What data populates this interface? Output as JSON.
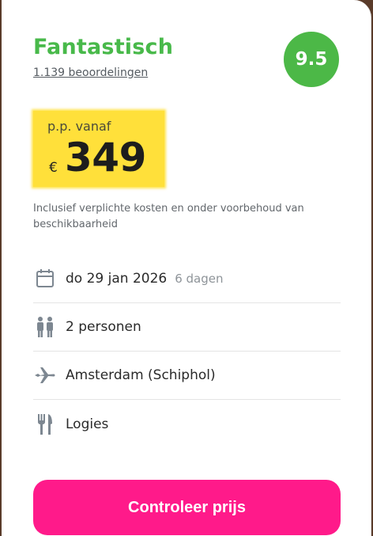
{
  "rating": {
    "word": "Fantastisch",
    "reviews_link": "1.139 beoordelingen",
    "score": "9.5"
  },
  "price": {
    "prefix": "p.p. vanaf",
    "currency": "€",
    "amount": "349"
  },
  "disclaimer": "Inclusief verplichte kosten en onder voorbehoud van beschikbaarheid",
  "details": [
    {
      "icon": "calendar-icon",
      "label": "do 29 jan 2026",
      "sub": "6 dagen"
    },
    {
      "icon": "persons-icon",
      "label": "2 personen",
      "sub": ""
    },
    {
      "icon": "airplane-icon",
      "label": "Amsterdam (Schiphol)",
      "sub": ""
    },
    {
      "icon": "cutlery-icon",
      "label": "Logies",
      "sub": ""
    }
  ],
  "cta_label": "Controleer prijs",
  "colors": {
    "rating_green": "#48b94a",
    "price_highlight": "#ffe03a",
    "cta_pink": "#ff1a8a",
    "icon_gray": "#7d8791"
  }
}
